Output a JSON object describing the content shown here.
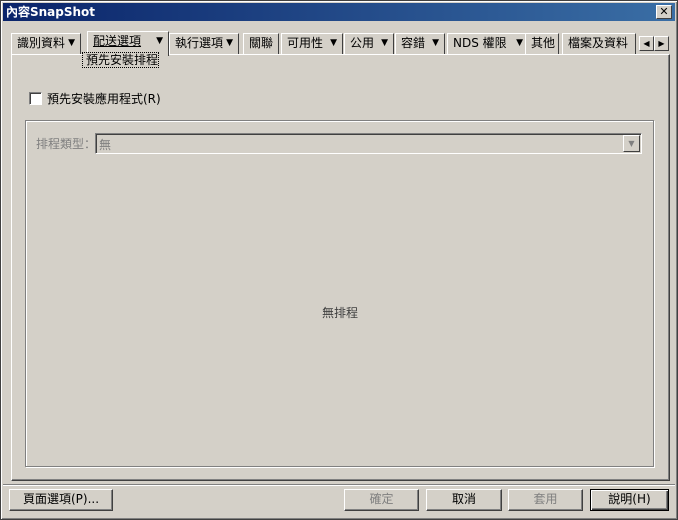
{
  "window": {
    "title": "內容SnapShot",
    "close_glyph": "✕"
  },
  "tabs": [
    {
      "label": "識別資料",
      "arrow": "▼"
    },
    {
      "label": "配送選項",
      "arrow": "▼"
    },
    {
      "label": "執行選項",
      "arrow": "▼"
    },
    {
      "label": "關聯"
    },
    {
      "label": "可用性",
      "arrow": "▼"
    },
    {
      "label": "公用",
      "arrow": "▼"
    },
    {
      "label": "容錯",
      "arrow": "▼"
    },
    {
      "label": "NDS 權限",
      "arrow": "▼"
    },
    {
      "label": "其他"
    },
    {
      "label": "檔案及資料"
    }
  ],
  "active_tab_index": 1,
  "sub_tab": {
    "label": "預先安裝排程"
  },
  "tab_scroll": {
    "left": "◀",
    "right": "▶"
  },
  "page": {
    "preinstall_checkbox": {
      "label": "預先安裝應用程式(R)",
      "checked": false
    },
    "schedule": {
      "type_label": "排程類型：",
      "type_value": "無",
      "dropdown_glyph": "▼",
      "empty_text": "無排程"
    }
  },
  "buttons": {
    "page_options": "頁面選項(P)...",
    "ok": "確定",
    "cancel": "取消",
    "apply": "套用",
    "help": "說明(H)"
  }
}
